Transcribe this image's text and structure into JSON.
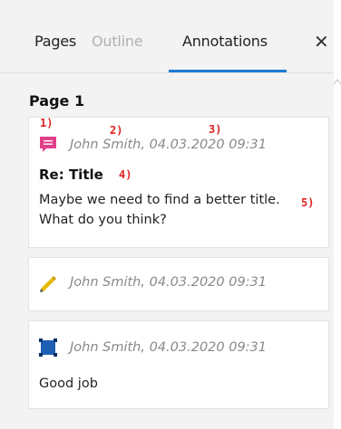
{
  "tabs": {
    "pages": "Pages",
    "outline": "Outline",
    "annotations": "Annotations",
    "close": "✕"
  },
  "page": {
    "title": "Page 1"
  },
  "annotations": [
    {
      "author": "John Smith",
      "date": ", 04.03.2020 09:31",
      "subject": "Re: Title",
      "text_line1": "Maybe we need to find a better title.",
      "text_line2": "What do you think?",
      "icon": "comment-icon",
      "color": "#e0408a"
    },
    {
      "author": "John Smith",
      "date": ", 04.03.2020 09:31",
      "icon": "pencil-icon",
      "color": "#e6b800"
    },
    {
      "author": "John Smith",
      "date": ", 04.03.2020 09:31",
      "text": "Good job",
      "icon": "square-icon",
      "color": "#1e5fb4"
    }
  ],
  "callouts": [
    "1)",
    "2)",
    "3)",
    "4)",
    "5)"
  ],
  "colors": {
    "accent": "#1e7bd3",
    "callout": "#e02020"
  }
}
